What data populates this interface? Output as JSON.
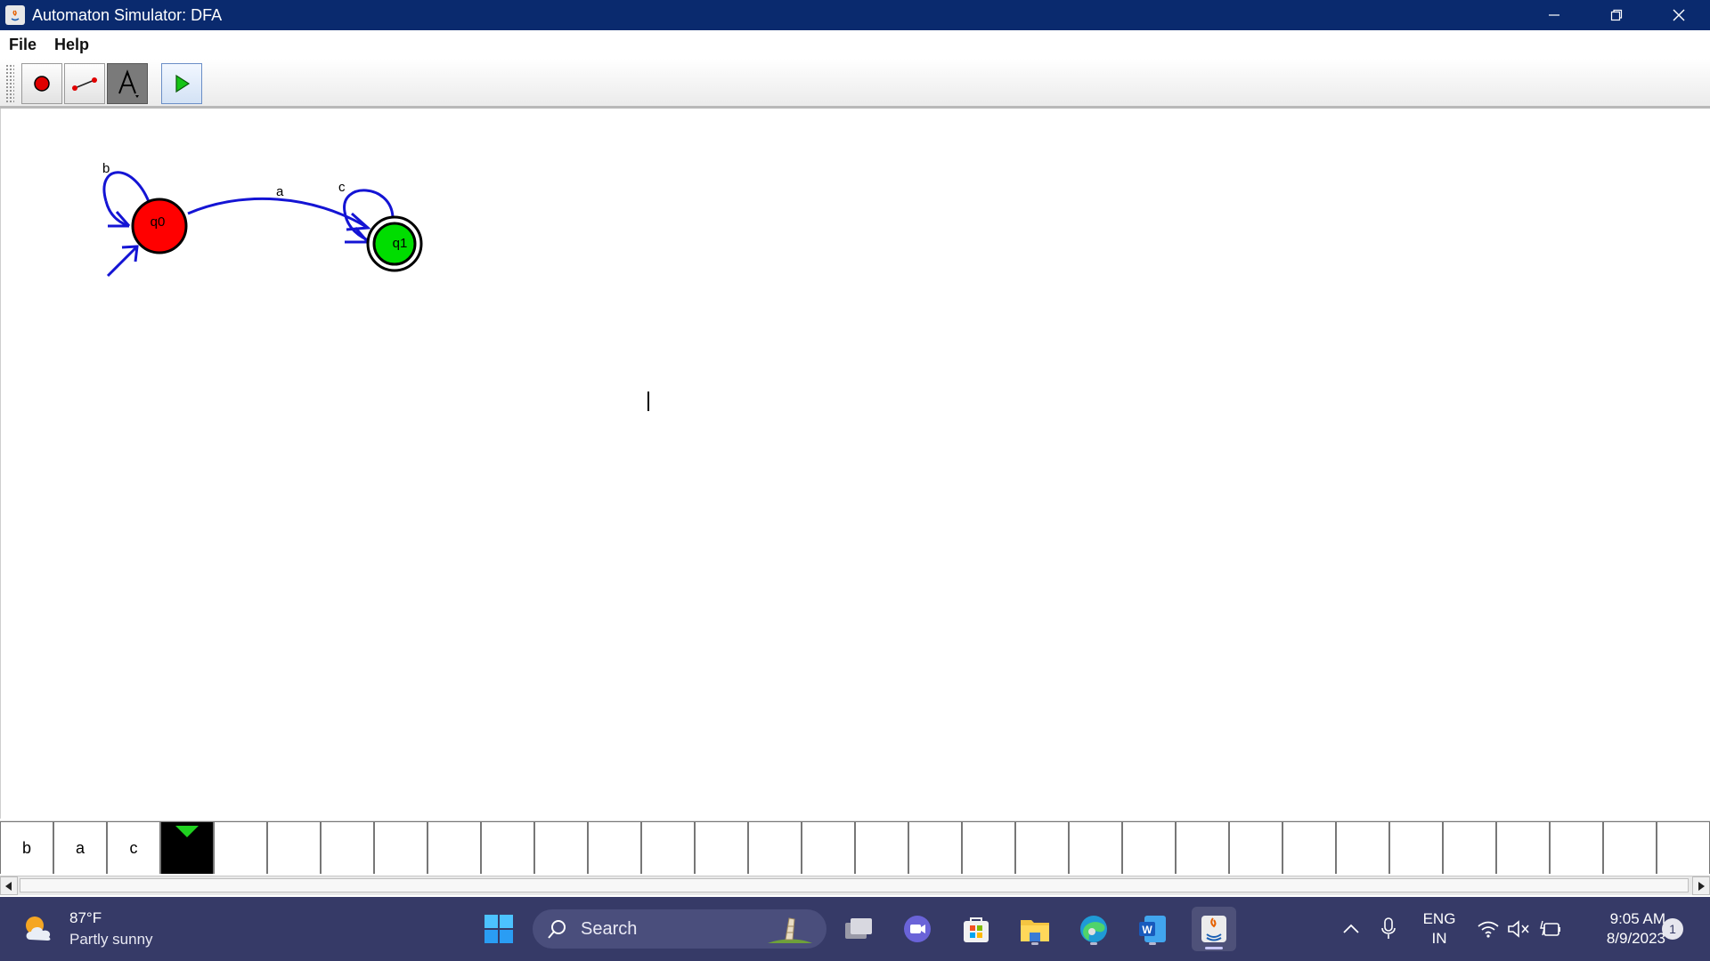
{
  "window": {
    "title": "Automaton Simulator: DFA"
  },
  "menu": {
    "items": [
      "File",
      "Help"
    ]
  },
  "toolbar": {
    "tools": [
      "state-tool",
      "transition-tool",
      "text-tool",
      "run-tool"
    ]
  },
  "automaton": {
    "states": [
      {
        "name": "q0",
        "initial": true,
        "accepting": false,
        "color": "#ff0000"
      },
      {
        "name": "q1",
        "initial": false,
        "accepting": true,
        "color": "#00dd00"
      }
    ],
    "transitions": [
      {
        "from": "q0",
        "to": "q0",
        "label": "b"
      },
      {
        "from": "q0",
        "to": "q1",
        "label": "a"
      },
      {
        "from": "q1",
        "to": "q1",
        "label": "c"
      }
    ],
    "edge_color": "#1414d4"
  },
  "tape": {
    "cells": [
      "b",
      "a",
      "c",
      "",
      "",
      "",
      "",
      "",
      "",
      "",
      "",
      "",
      "",
      "",
      "",
      "",
      "",
      "",
      "",
      "",
      "",
      "",
      "",
      "",
      "",
      "",
      "",
      "",
      "",
      "",
      "",
      ""
    ],
    "head_index": 3
  },
  "taskbar": {
    "weather": {
      "temp": "87°F",
      "condition": "Partly sunny"
    },
    "search_label": "Search",
    "language": {
      "line1": "ENG",
      "line2": "IN"
    },
    "clock": {
      "time": "9:05 AM",
      "date": "8/9/2023"
    },
    "notification_count": "1"
  }
}
